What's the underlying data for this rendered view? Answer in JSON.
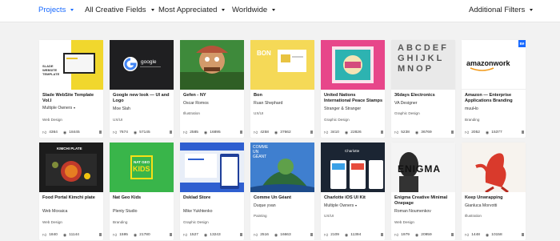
{
  "nav": {
    "projects": "Projects",
    "fields": "All Creative Fields",
    "sort": "Most Appreciated",
    "location": "Worldwide",
    "filters": "Additional Filters"
  },
  "colors": {
    "accent": "#1769ff"
  },
  "cards": [
    {
      "title": "Slade WebSite Template Vol.I",
      "owner": "Multiple Owners",
      "multi": true,
      "field": "Web Design",
      "likes": "4364",
      "views": "18445"
    },
    {
      "title": "Google new look — UI and Logo",
      "owner": "Moe Slah",
      "multi": false,
      "field": "UX/UI",
      "likes": "7674",
      "views": "57145"
    },
    {
      "title": "Gefen - NY",
      "owner": "Oscar Romos",
      "multi": false,
      "field": "Illustration",
      "likes": "2585",
      "views": "16895"
    },
    {
      "title": "Bon",
      "owner": "Ruan Shephard",
      "multi": false,
      "field": "UX/UI",
      "likes": "4258",
      "views": "37662"
    },
    {
      "title": "United Nations International Peace Stamps",
      "owner": "Stranger & Stranger",
      "multi": false,
      "field": "Graphic Design",
      "likes": "3410",
      "views": "22826"
    },
    {
      "title": "36days Electronics",
      "owner": "VA Designer",
      "multi": false,
      "field": "Graphic Design",
      "likes": "5238",
      "views": "36769"
    },
    {
      "title": "Amazon — Enterprise Applications Branding",
      "owner": "muuHo",
      "multi": false,
      "field": "Branding",
      "likes": "2052",
      "views": "15377"
    },
    {
      "title": "Food Portal Kimchi plate",
      "owner": "Web Moxaica",
      "multi": false,
      "field": "Web Design",
      "likes": "1840",
      "views": "11144"
    },
    {
      "title": "Nat Geo Kids",
      "owner": "Plenty Studio",
      "multi": false,
      "field": "Branding",
      "likes": "1595",
      "views": "21780"
    },
    {
      "title": "Dsklad Store",
      "owner": "Mike Yukhtenko",
      "multi": false,
      "field": "Graphic Design",
      "likes": "1527",
      "views": "13243"
    },
    {
      "title": "Comme Un Géant",
      "owner": "Duque yvan",
      "multi": false,
      "field": "Painting",
      "likes": "2516",
      "views": "16663"
    },
    {
      "title": "Charlotte iOS UI Kit",
      "owner": "Multiple Owners",
      "multi": true,
      "field": "UX/UI",
      "likes": "2109",
      "views": "11394"
    },
    {
      "title": "Enigma Creative Minimal Onepage",
      "owner": "Roman Noumenkov",
      "multi": false,
      "field": "Web Design",
      "likes": "1979",
      "views": "20959"
    },
    {
      "title": "Keep Unwrapping",
      "owner": "Gianluca Morvotti",
      "multi": false,
      "field": "Illustration",
      "likes": "1448",
      "views": "10158"
    }
  ],
  "thumb_text": {
    "slade": "SLADE\nWEBSITE\nTEMPLATE",
    "google": "google",
    "bon": "BON",
    "letters": "ABCDEFGHIJKLMNOP",
    "amazon": "amazonwork",
    "be": "Bē",
    "kimchi": "KIMCHI PLATE",
    "natgeo_top": "NAT GEO",
    "natgeo_kids": "KIDS",
    "comme": "COMME\nUN\nGÉANT",
    "charlotte": "Charlotte",
    "enigma": "ENIGMA"
  }
}
